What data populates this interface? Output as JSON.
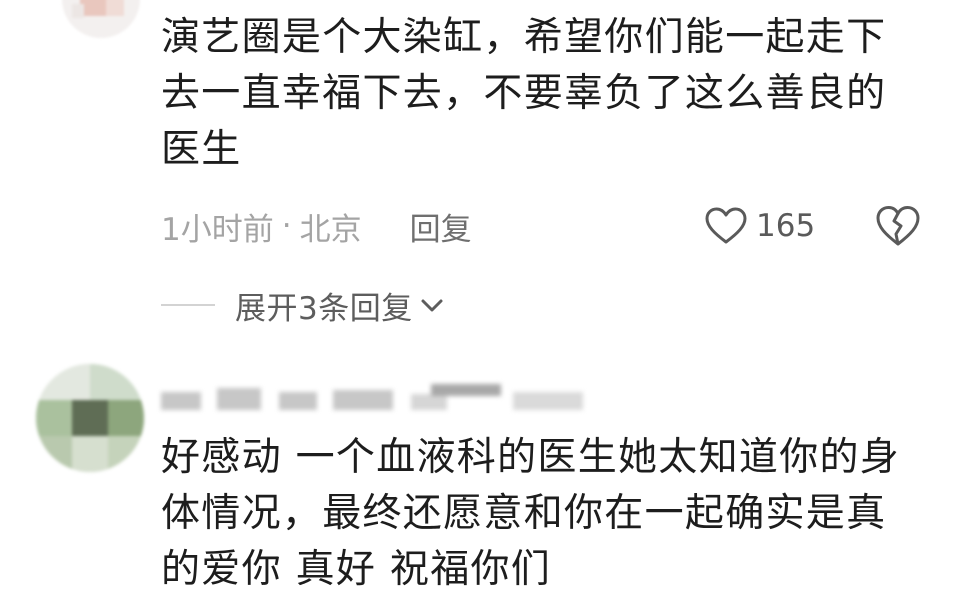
{
  "comments": [
    {
      "text": "演艺圈是个大染缸，希望你们能一起走下\n去一直幸福下去，不要辜负了这么善良的\n医生",
      "time": "1小时前",
      "separator": "·",
      "location": "北京",
      "reply_label": "回复",
      "like_count": "165",
      "expand_label": "展开3条回复"
    },
    {
      "text": "好感动 一个血液科的医生她太知道你的身\n体情况，最终还愿意和你在一起确实是真\n的爱你 真好 祝福你们"
    }
  ],
  "icons": {
    "like": "heart-outline-icon",
    "dislike": "broken-heart-icon",
    "expand": "chevron-down-icon"
  },
  "colors": {
    "text_primary": "#1d1d1d",
    "text_meta": "#a4a4a4",
    "text_secondary": "#5d5d5d",
    "divider": "#d3d3d3"
  }
}
